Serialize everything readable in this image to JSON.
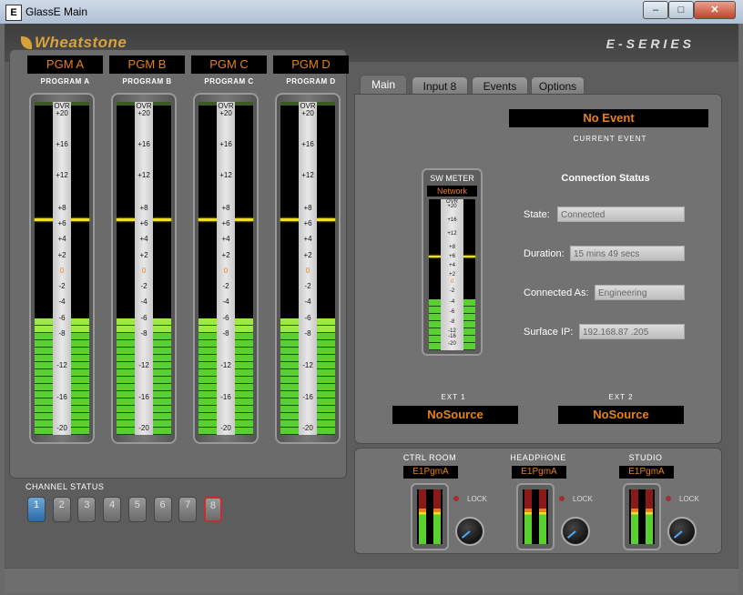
{
  "window": {
    "title": "GlassE Main",
    "icon_letter": "E",
    "min": "–",
    "max": "□",
    "close": "✕"
  },
  "header": {
    "logo": "Wheatstone",
    "series": "E-SERIES"
  },
  "programs": [
    {
      "pgm": "PGM A",
      "label": "PROGRAM A"
    },
    {
      "pgm": "PGM B",
      "label": "PROGRAM B"
    },
    {
      "pgm": "PGM C",
      "label": "PROGRAM C"
    },
    {
      "pgm": "PGM D",
      "label": "PROGRAM D"
    }
  ],
  "scale": [
    "OVR",
    "+20",
    "+16",
    "+12",
    "+8",
    "+6",
    "+4",
    "+2",
    "0",
    "-2",
    "-4",
    "-6",
    "-8",
    "-12",
    "-16",
    "-20"
  ],
  "channel_status": {
    "label": "CHANNEL STATUS",
    "channels": [
      "1",
      "2",
      "3",
      "4",
      "5",
      "6",
      "7",
      "8"
    ],
    "selected": "1"
  },
  "tabs": [
    "Main",
    "Input 8",
    "Events",
    "Options"
  ],
  "event": {
    "value": "No Event",
    "caption": "CURRENT   EVENT"
  },
  "sw_meter": {
    "label": "SW METER",
    "source": "Network"
  },
  "connection": {
    "title": "Connection Status",
    "state_label": "State:",
    "state": "Connected",
    "duration_label": "Duration:",
    "duration": "15 mins 49 secs",
    "as_label": "Connected As:",
    "as": "Engineering",
    "ip_label": "Surface IP:",
    "ip": "192.168.87 .205"
  },
  "ext": [
    {
      "label": "EXT 1",
      "value": "NoSource"
    },
    {
      "label": "EXT 2",
      "value": "NoSource"
    }
  ],
  "monitors": [
    {
      "label": "CTRL ROOM",
      "source": "E1PgmA",
      "lock": "LOCK"
    },
    {
      "label": "HEADPHONE",
      "source": "E1PgmA",
      "lock": "LOCK"
    },
    {
      "label": "STUDIO",
      "source": "E1PgmA",
      "lock": "LOCK"
    }
  ]
}
